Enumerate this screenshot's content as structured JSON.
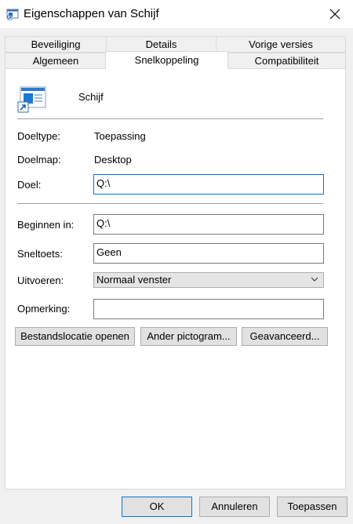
{
  "window": {
    "title": "Eigenschappen van Schijf"
  },
  "tabs": {
    "row_back": [
      "Beveiliging",
      "Details",
      "Vorige versies"
    ],
    "row_front": [
      "Algemeen",
      "Snelkoppeling",
      "Compatibiliteit"
    ],
    "active": "Snelkoppeling"
  },
  "shortcut": {
    "name": "Schijf",
    "doeltype_label": "Doeltype:",
    "doeltype_value": "Toepassing",
    "doelmap_label": "Doelmap:",
    "doelmap_value": "Desktop",
    "doel_label": "Doel:",
    "doel_value": "Q:\\",
    "beginnen_label": "Beginnen in:",
    "beginnen_value": "Q:\\",
    "sneltoets_label": "Sneltoets:",
    "sneltoets_value": "Geen",
    "uitvoeren_label": "Uitvoeren:",
    "uitvoeren_value": "Normaal venster",
    "opmerking_label": "Opmerking:",
    "opmerking_value": ""
  },
  "actions": {
    "open_location": "Bestandslocatie openen",
    "change_icon": "Ander pictogram...",
    "advanced": "Geavanceerd..."
  },
  "footer": {
    "ok": "OK",
    "cancel": "Annuleren",
    "apply": "Toepassen"
  },
  "icons": {
    "title": "shortcut-icon",
    "close": "close-icon",
    "big": "shortcut-app-icon",
    "dropdown": "chevron-down-icon"
  }
}
